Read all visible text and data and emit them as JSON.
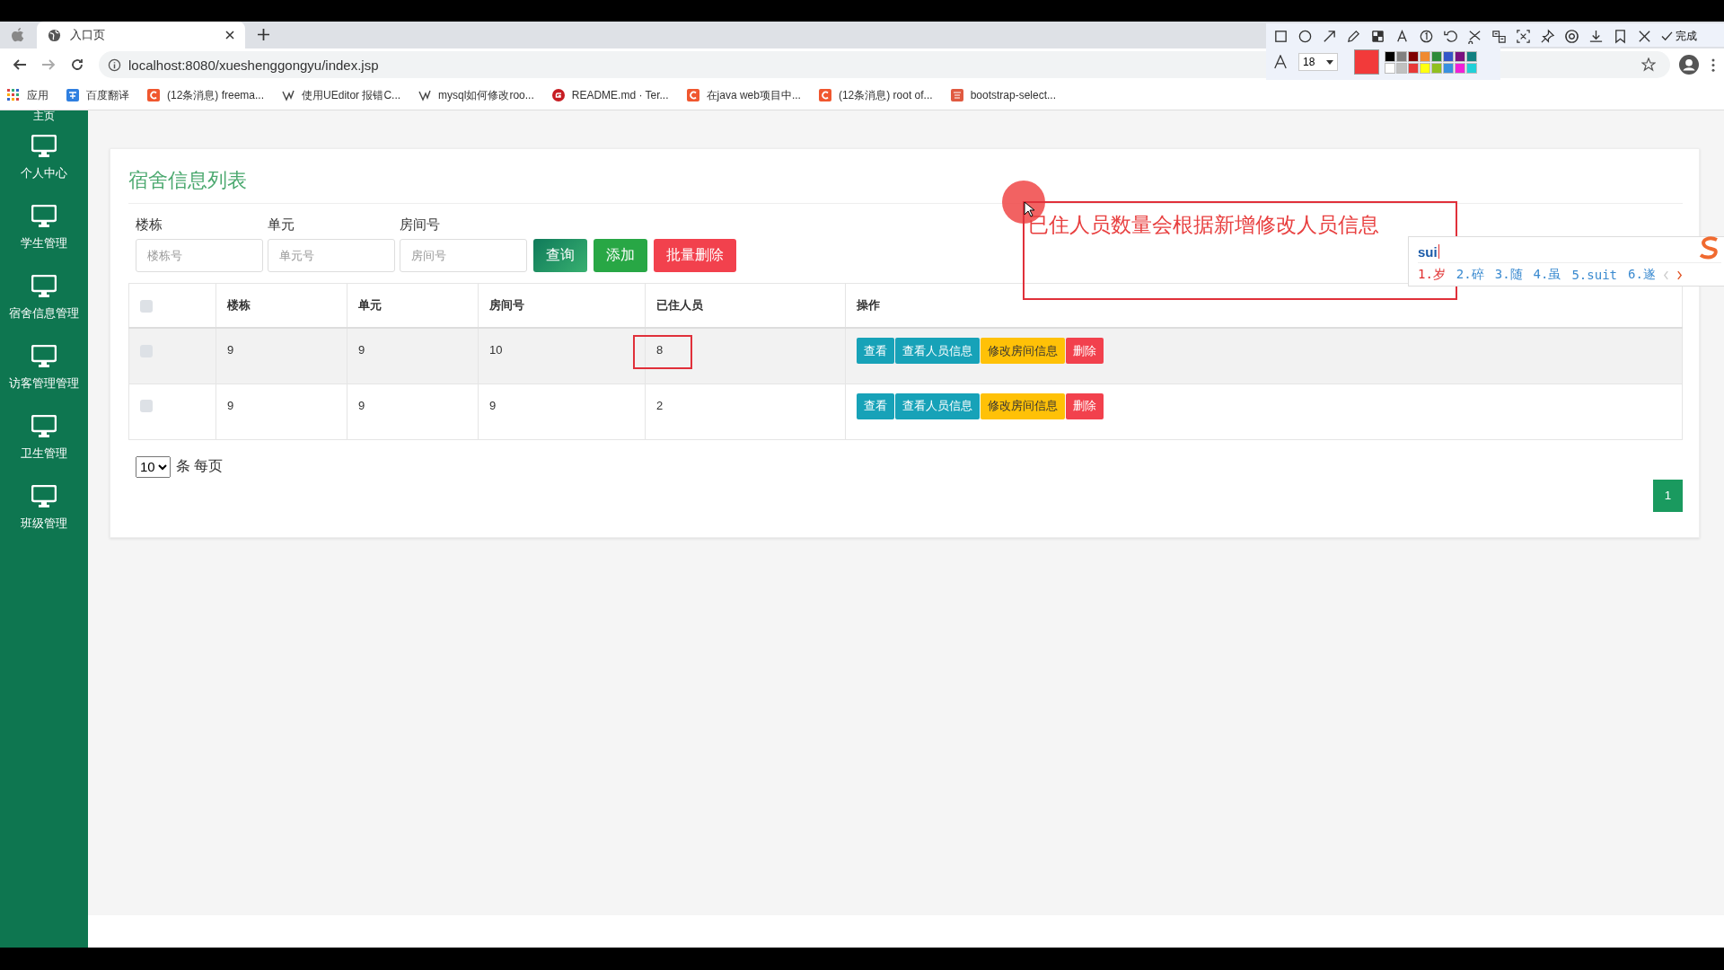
{
  "browser": {
    "tab_title": "入口页",
    "url": "localhost:8080/xueshenggongyu/index.jsp",
    "bookmarks": [
      {
        "label": "应用",
        "kind": "apps"
      },
      {
        "label": "百度翻译",
        "kind": "translate"
      },
      {
        "label": "(12条消息) freema...",
        "kind": "csdn"
      },
      {
        "label": "使用UEditor 报错C...",
        "kind": "link"
      },
      {
        "label": "mysql如何修改roo...",
        "kind": "link"
      },
      {
        "label": "README.md · Ter...",
        "kind": "gitee"
      },
      {
        "label": "在java web项目中...",
        "kind": "csdn"
      },
      {
        "label": "(12条消息) root of...",
        "kind": "csdn"
      },
      {
        "label": "bootstrap-select...",
        "kind": "jian"
      }
    ]
  },
  "capture_toolbar": {
    "done": "完成",
    "font_size": "18",
    "current_swatch": {
      "color": "#f23a3a"
    },
    "swatches": [
      {
        "color": "#000000"
      },
      {
        "color": "#808080"
      },
      {
        "color": "#7f0000"
      },
      {
        "color": "#f08a30"
      },
      {
        "color": "#2e8b3a"
      },
      {
        "color": "#3456c8"
      },
      {
        "color": "#7a1080"
      },
      {
        "color": "#118080"
      },
      {
        "color": "#ffffff"
      },
      {
        "color": "#c0c0c0"
      },
      {
        "color": "#e83838"
      },
      {
        "color": "#ffff10"
      },
      {
        "color": "#90c020"
      },
      {
        "color": "#3890e0"
      },
      {
        "color": "#f020d8"
      },
      {
        "color": "#20d0d8"
      }
    ]
  },
  "sidebar": {
    "top_label": "主页",
    "items": [
      {
        "label": "个人中心"
      },
      {
        "label": "学生管理"
      },
      {
        "label": "宿舍信息管理"
      },
      {
        "label": "访客管理管理"
      },
      {
        "label": "卫生管理"
      },
      {
        "label": "班级管理"
      }
    ]
  },
  "panel": {
    "title": "宿舍信息列表",
    "filters": [
      {
        "label": "楼栋",
        "placeholder": "楼栋号"
      },
      {
        "label": "单元",
        "placeholder": "单元号"
      },
      {
        "label": "房间号",
        "placeholder": "房间号"
      }
    ],
    "buttons": [
      {
        "label": "查询",
        "kind": "query"
      },
      {
        "label": "添加",
        "kind": "add"
      },
      {
        "label": "批量删除",
        "kind": "danger"
      }
    ],
    "table": {
      "select_all": {
        "checked": false
      },
      "columns": [
        "楼栋",
        "单元",
        "房间号",
        "已住人员",
        "操作"
      ],
      "rows": [
        {
          "checked": false,
          "hovered": true,
          "cells": [
            "9",
            "9",
            "10",
            "8"
          ],
          "marked": true,
          "actions": [
            {
              "label": "查看",
              "kind": "info"
            },
            {
              "label": "查看人员信息",
              "kind": "info"
            },
            {
              "label": "修改房间信息",
              "kind": "warning"
            },
            {
              "label": "删除",
              "kind": "danger"
            }
          ]
        },
        {
          "checked": false,
          "hovered": false,
          "cells": [
            "9",
            "9",
            "9",
            "2"
          ],
          "marked": false,
          "actions": [
            {
              "label": "查看",
              "kind": "info"
            },
            {
              "label": "查看人员信息",
              "kind": "info"
            },
            {
              "label": "修改房间信息",
              "kind": "warning"
            },
            {
              "label": "删除",
              "kind": "danger"
            }
          ]
        }
      ]
    },
    "page_size": "10",
    "per_page_label": "条 每页",
    "pages": [
      {
        "label": "1",
        "selected": true
      }
    ]
  },
  "annotation": {
    "text": "已住人员数量会根据新增修改人员信息"
  },
  "ime": {
    "input": "sui",
    "candidates": [
      {
        "label": "1.岁",
        "selected": true
      },
      {
        "label": "2.碎",
        "selected": false
      },
      {
        "label": "3.随",
        "selected": false
      },
      {
        "label": "4.虽",
        "selected": false
      },
      {
        "label": "5.suit",
        "selected": false
      },
      {
        "label": "6.遂",
        "selected": false
      }
    ]
  }
}
